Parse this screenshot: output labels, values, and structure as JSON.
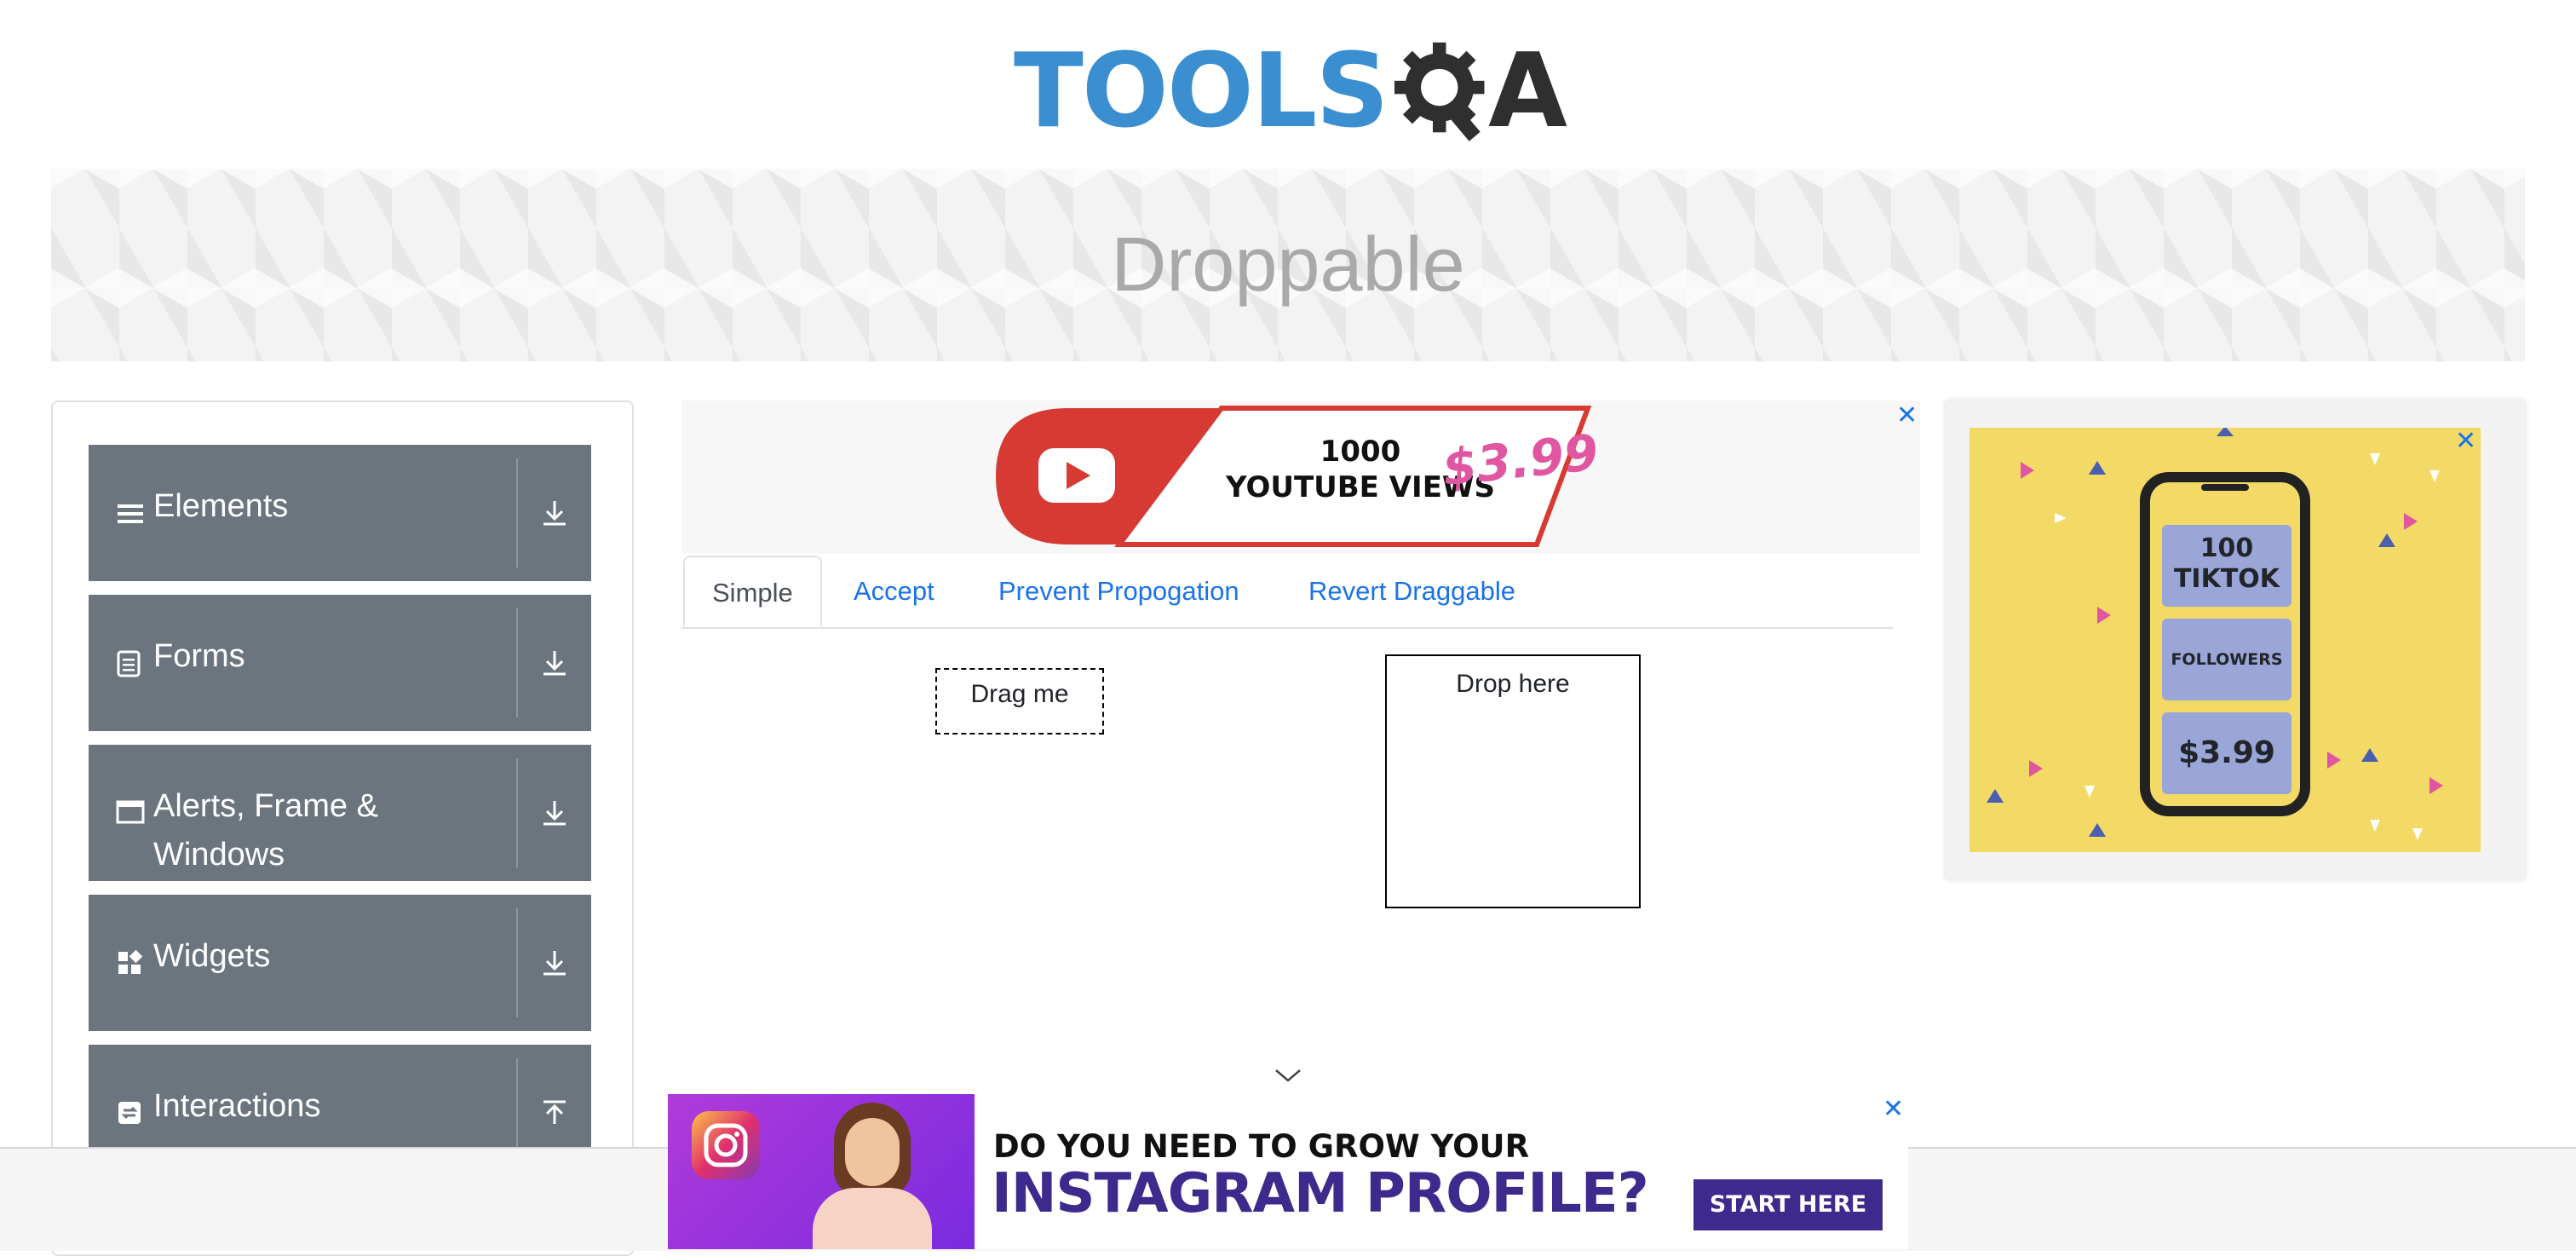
{
  "logo": {
    "text_left": "TOOLS",
    "text_right": "A"
  },
  "banner": {
    "title": "Droppable"
  },
  "sidebar": {
    "groups": [
      {
        "label": "Elements",
        "icon": "list-icon",
        "toggle_icon": "download-arrow-icon"
      },
      {
        "label": "Forms",
        "icon": "document-icon",
        "toggle_icon": "download-arrow-icon"
      },
      {
        "label": "Alerts, Frame & Windows",
        "icon": "window-icon",
        "toggle_icon": "download-arrow-icon"
      },
      {
        "label": "Widgets",
        "icon": "widgets-icon",
        "toggle_icon": "download-arrow-icon"
      },
      {
        "label": "Interactions",
        "icon": "interactions-icon",
        "toggle_icon": "upload-arrow-icon"
      }
    ]
  },
  "ad_top": {
    "line1": "1000",
    "line2": "YOUTUBE VIEWS",
    "price": "$3.99",
    "close": "✕"
  },
  "ad_right": {
    "box1_line1": "100",
    "box1_line2": "TIKTOK",
    "box2": "FOLLOWERS",
    "box3": "$3.99",
    "close": "✕"
  },
  "tabs": [
    {
      "label": "Simple",
      "active": true
    },
    {
      "label": "Accept",
      "active": false
    },
    {
      "label": "Prevent Propogation",
      "active": false
    },
    {
      "label": "Revert Draggable",
      "active": false
    }
  ],
  "draggable": {
    "label": "Drag me"
  },
  "droppable": {
    "label": "Drop here"
  },
  "ad_bottom": {
    "line1": "DO YOU NEED TO GROW YOUR",
    "line2": "INSTAGRAM PROFILE?",
    "cta": "START HERE",
    "close": "✕"
  },
  "colors": {
    "accent": "#1a73e8",
    "sidebar_group": "#6c757d",
    "logo_blue": "#3b8fd0",
    "tiktok_bg": "#f3d966",
    "insta_purple": "#3e2a8c"
  }
}
